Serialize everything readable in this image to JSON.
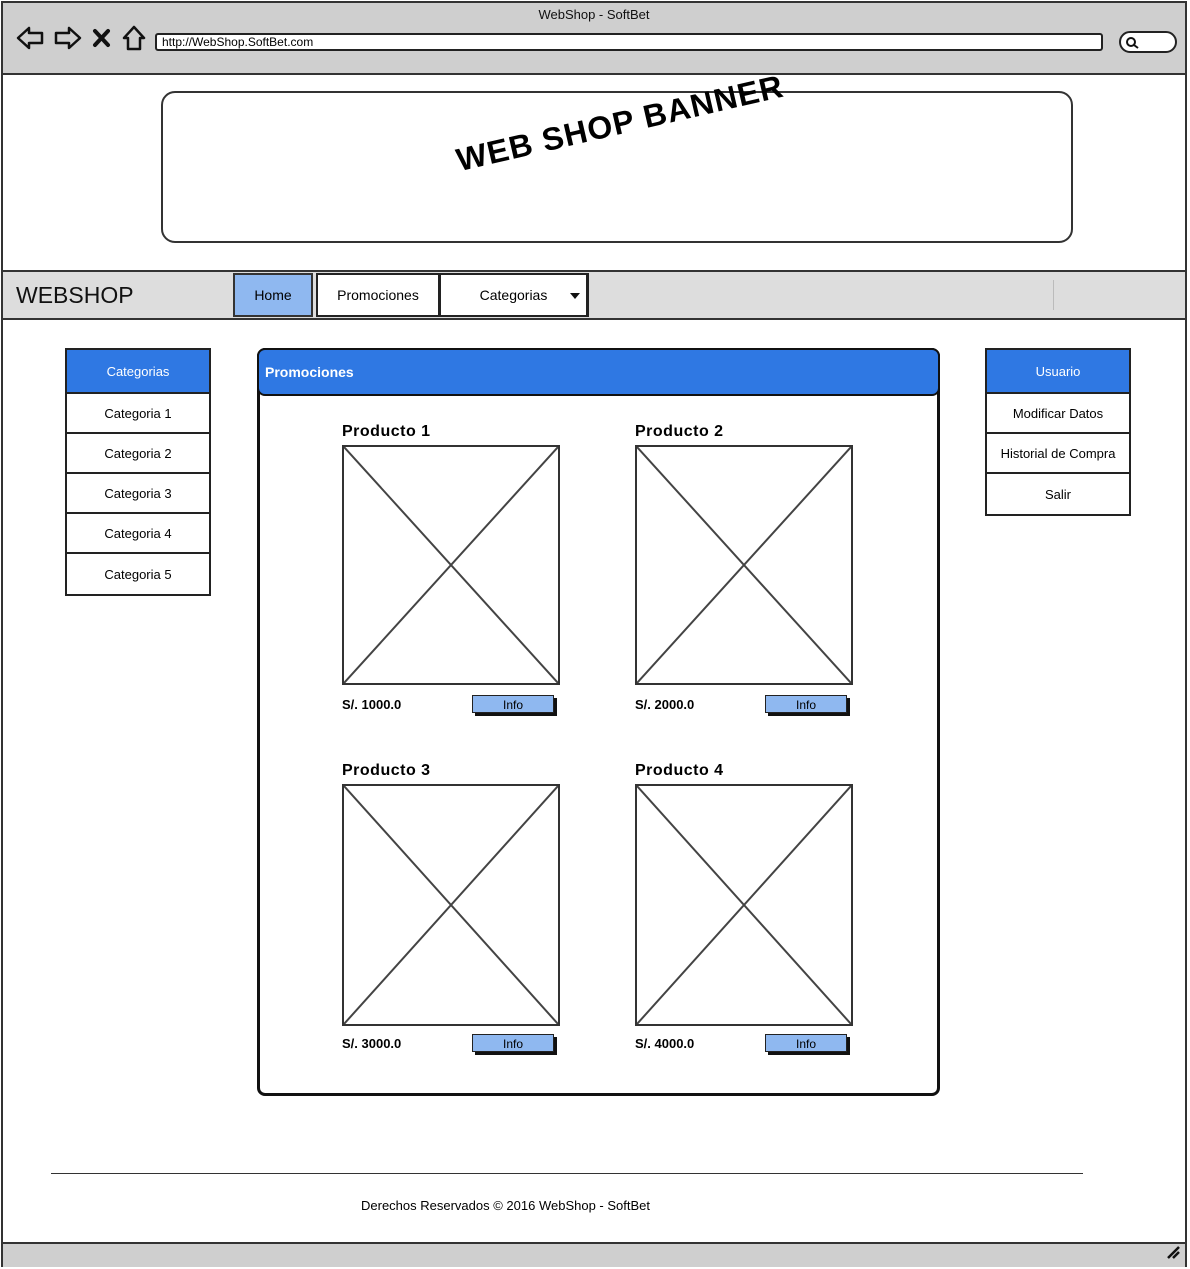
{
  "window": {
    "title": "WebShop - SoftBet",
    "url": "http://WebShop.SoftBet.com"
  },
  "banner": {
    "text": "WEB SHOP BANNER"
  },
  "nav": {
    "brand": "WEBSHOP",
    "tabs": [
      {
        "label": "Home",
        "active": true
      },
      {
        "label": "Promociones"
      },
      {
        "label": "Categorias"
      }
    ]
  },
  "categories": {
    "title": "Categorias",
    "items": [
      "Categoria 1",
      "Categoria 2",
      "Categoria 3",
      "Categoria 4",
      "Categoria 5"
    ]
  },
  "promo": {
    "title": "Promociones",
    "products": [
      {
        "name": "Producto 1",
        "price": "S/. 1000.0",
        "button": "Info"
      },
      {
        "name": "Producto 2",
        "price": "S/. 2000.0",
        "button": "Info"
      },
      {
        "name": "Producto 3",
        "price": "S/. 3000.0",
        "button": "Info"
      },
      {
        "name": "Producto 4",
        "price": "S/. 4000.0",
        "button": "Info"
      }
    ]
  },
  "user": {
    "title": "Usuario",
    "items": [
      "Modificar Datos",
      "Historial de Compra",
      "Salir"
    ]
  },
  "footer": {
    "text": "Derechos Reservados © 2016 WebShop - SoftBet"
  },
  "colors": {
    "accent": "#2f78e3",
    "active_tab": "#8fb8f0",
    "chrome": "#cfcfcf"
  }
}
